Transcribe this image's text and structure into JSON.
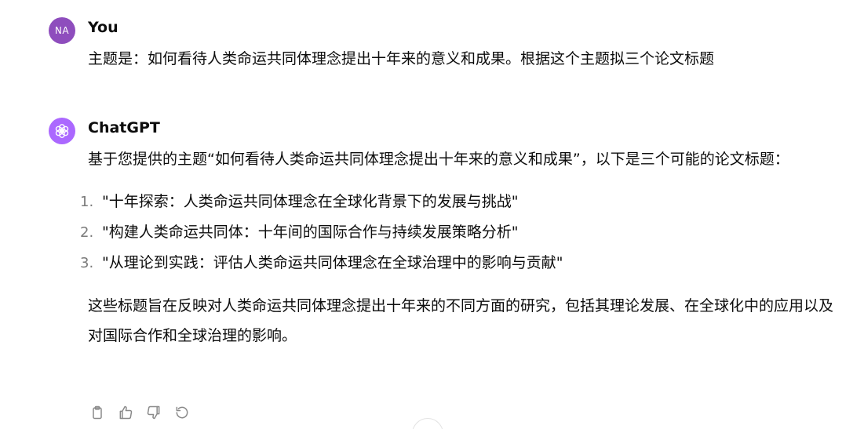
{
  "conversation": {
    "user_message": {
      "avatar_initials": "NA",
      "author": "You",
      "text": "主题是：如何看待人类命运共同体理念提出十年来的意义和成果。根据这个主题拟三个论文标题"
    },
    "assistant_message": {
      "author": "ChatGPT",
      "intro": "基于您提供的主题“如何看待人类命运共同体理念提出十年来的意义和成果”，以下是三个可能的论文标题：",
      "titles": [
        {
          "num": "1.",
          "text": "\"十年探索：人类命运共同体理念在全球化背景下的发展与挑战\""
        },
        {
          "num": "2.",
          "text": "\"构建人类命运共同体：十年间的国际合作与持续发展策略分析\""
        },
        {
          "num": "3.",
          "text": "\"从理论到实践：评估人类命运共同体理念在全球治理中的影响与贡献\""
        }
      ],
      "summary": "这些标题旨在反映对人类命运共同体理念提出十年来的不同方面的研究，包括其理论发展、在全球化中的应用以及对国际合作和全球治理的影响。"
    },
    "colors": {
      "user_avatar": "#8e4dbd",
      "assistant_avatar": "#ab68ff",
      "icon": "#8a8a8a"
    },
    "action_icons": [
      "clipboard-icon",
      "thumbs-up-icon",
      "thumbs-down-icon",
      "regenerate-icon"
    ]
  }
}
